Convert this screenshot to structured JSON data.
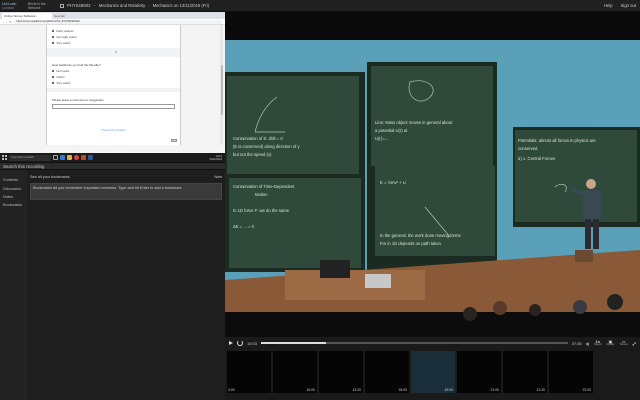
{
  "topbar": {
    "logo_line1": "Uni Lndn",
    "logo_line2": "London",
    "nav_line1": "Brickt in the",
    "nav_line2": "Network",
    "course_code": "PHYS4B002",
    "course_title": "Mechanics and Relativity",
    "lecture_title": "Mechanics on 13/11/2019 (Fri)",
    "help_label": "Help",
    "signin_label": "Sign out"
  },
  "screen_share": {
    "tab1": "Online Survey Software",
    "tab2": "New tab",
    "address": "https://xxxxx.qualtrics.com/jfe/form/SV_6Xd7X5r4K6sR",
    "options_top": [
      "Fairly useless",
      "Not really useful",
      "Very useful"
    ],
    "question": "How helpful do you find the Moodle?",
    "options_bottom": [
      "Not useful",
      "Useful",
      "Very useful"
    ],
    "divider_text": "||",
    "comment_prompt": "Please leave a comment or suggestion",
    "footer": "Powered by Qualtrics",
    "taskbar_search": "Type here to search",
    "clock_time": "10:12",
    "clock_date": "13/11/2019"
  },
  "left_panel": {
    "search_text": "Search this recording",
    "nav_items": [
      "Contents",
      "Discussion",
      "Notes",
      "Bookmarks"
    ],
    "bookmarks_title": "See all your bookmarks",
    "bookmarks_action": "New",
    "bookmarks_message": "Bookmarks let you remember important moments. Type and hit Enter to add a bookmark."
  },
  "controls": {
    "current_time": "10:03",
    "duration": "47:35",
    "progress": 0.213,
    "speed_label": "1x",
    "speed_sub": "Speed",
    "quality_sub": "Quality",
    "screen_label": "Screen",
    "track_label": "Track"
  },
  "thumbnails": [
    {
      "label": "0:00",
      "active": false
    },
    {
      "label": "10:00",
      "active": false
    },
    {
      "label": "13:20",
      "active": false
    },
    {
      "label": "18:00",
      "active": false
    },
    {
      "label": "19:00",
      "active": true
    },
    {
      "label": "21:00",
      "active": false
    },
    {
      "label": "21:30",
      "active": false
    },
    {
      "label": "22:00",
      "active": false
    }
  ],
  "blackboard": {
    "board1": [
      "Conservation of E: d/dt = 0",
      "(E is conserved)  along direction of y",
      "but not the speed (v)"
    ],
    "board2": [
      "Line: Mass object moves in general about",
      "a potential U(r) at",
      "U(r)=..."
    ],
    "board3": [
      "Potentials: almost all forces in physics are",
      "conserved",
      "a) 1. Central Forces"
    ],
    "board4": [
      "Conservation of Time-Dependent",
      "Motion",
      "In 1D force F: we do the same",
      "ΔE = ... = 0"
    ],
    "board5": [
      "E = ½mv² + U",
      "In the general, the work done moving forms",
      "For in 1D depends on path taken"
    ]
  },
  "colors": {
    "background": "#1e1e1e",
    "board_green": "#2f4a3a",
    "wall_blue": "#5aa0b8"
  }
}
